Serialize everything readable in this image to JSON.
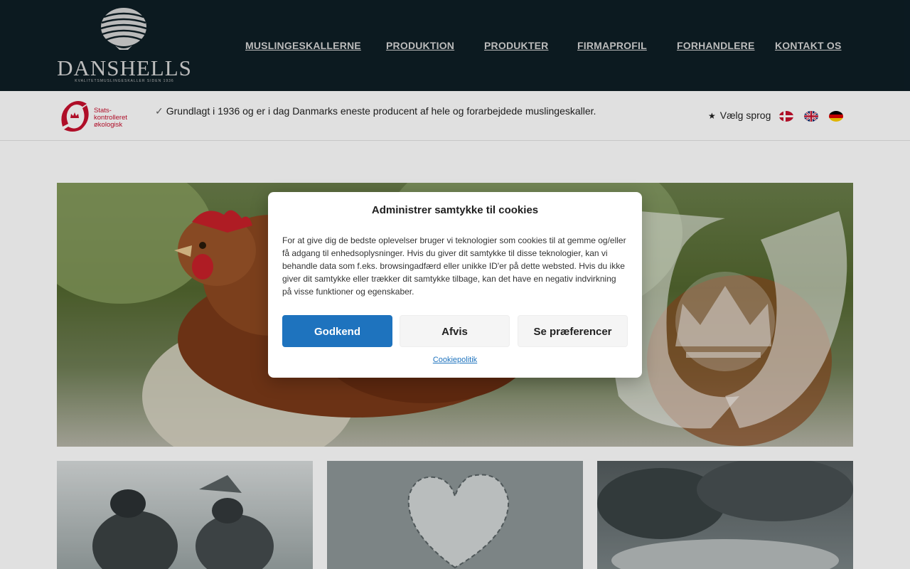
{
  "brand": {
    "name": "DANSHELLS",
    "tagline": "KVALITETSMUSLINGESKALLER SIDEN 1936"
  },
  "nav": {
    "items": [
      {
        "label": "MUSLINGESKALLERNE"
      },
      {
        "label": "PRODUKTION"
      },
      {
        "label": "PRODUKTER"
      },
      {
        "label": "FIRMAPROFIL"
      },
      {
        "label": "FORHANDLERE"
      },
      {
        "label": "KONTAKT OS"
      }
    ]
  },
  "infobar": {
    "organic_label_line1": "Stats-",
    "organic_label_line2": "kontrolleret",
    "organic_label_line3": "økologisk",
    "check": "✓",
    "tagline": "Grundlagt i 1936 og er i dag Danmarks eneste producent af hele og forarbejdede muslingeskaller.",
    "language_label": "Vælg sprog",
    "languages": [
      "da",
      "en",
      "de"
    ]
  },
  "cookie_modal": {
    "title": "Administrer samtykke til cookies",
    "body": "For at give dig de bedste oplevelser bruger vi teknologier som cookies til at gemme og/eller få adgang til enhedsoplysninger. Hvis du giver dit samtykke til disse teknologier, kan vi behandle data som f.eks. browsingadfærd eller unikke ID'er på dette websted. Hvis du ikke giver dit samtykke eller trækker dit samtykke tilbage, kan det have en negativ indvirkning på visse funktioner og egenskaber.",
    "accept_label": "Godkend",
    "deny_label": "Afvis",
    "preferences_label": "Se præferencer",
    "policy_link": "Cookiepolitik"
  },
  "colors": {
    "header_bg": "#0e1e25",
    "accent": "#1e73be",
    "organic_red": "#c8102e"
  }
}
